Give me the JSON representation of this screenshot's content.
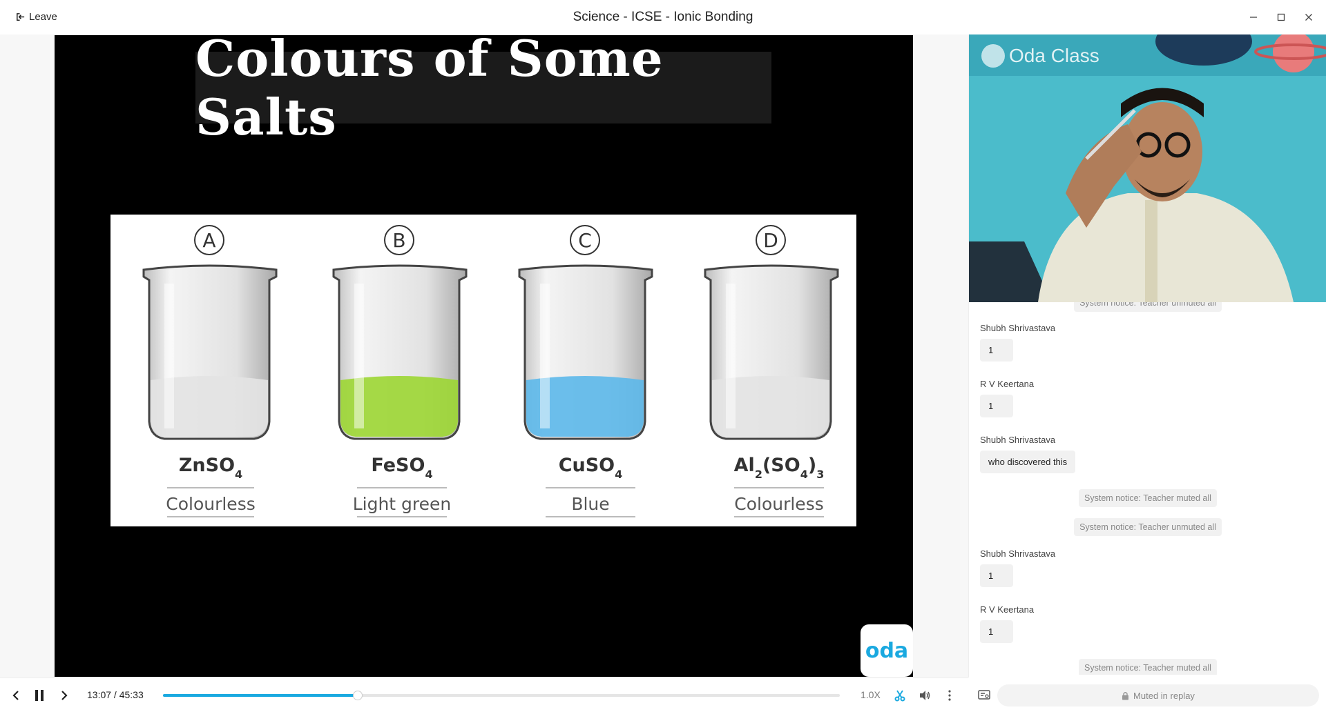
{
  "window": {
    "title": "Science - ICSE - Ionic Bonding",
    "leave_label": "Leave"
  },
  "slide": {
    "title": "Colours of Some Salts",
    "beakers": [
      {
        "letter": "A",
        "formula_main": "ZnSO",
        "formula_sub": "4",
        "colour_label": "Colourless",
        "liquid_color": "#e3e3e3"
      },
      {
        "letter": "B",
        "formula_main": "FeSO",
        "formula_sub": "4",
        "colour_label": "Light green",
        "liquid_color": "#9cd633"
      },
      {
        "letter": "C",
        "formula_main": "CuSO",
        "formula_sub": "4",
        "colour_label": "Blue",
        "liquid_color": "#5cb8ea"
      },
      {
        "letter": "D",
        "formula_main": "Al",
        "formula_sub": "2",
        "formula_mid": "(SO",
        "formula_sub2": "4",
        "formula_end": ")",
        "formula_sub3": "3",
        "colour_label": "Colourless",
        "liquid_color": "#e3e3e3"
      }
    ],
    "badge": "oda"
  },
  "video": {
    "watermark": "Oda Class"
  },
  "chat": {
    "top_notice_partial": "System notice: Teacher unmuted all",
    "messages": [
      {
        "name": "Shubh Shrivastava",
        "text": "1"
      },
      {
        "name": "R V Keertana",
        "text": "1"
      },
      {
        "name": "Shubh Shrivastava",
        "text": "who discovered this"
      },
      {
        "notice": "System notice: Teacher muted all"
      },
      {
        "notice": "System notice: Teacher unmuted all"
      },
      {
        "name": "Shubh Shrivastava",
        "text": "1"
      },
      {
        "name": "R V Keertana",
        "text": "1"
      },
      {
        "notice": "System notice: Teacher muted all"
      }
    ],
    "footer": "Muted in replay"
  },
  "player": {
    "time": "13:07 / 45:33",
    "progress": 0.288,
    "speed": "1.0X"
  },
  "colors": {
    "accent": "#1aa9e0"
  }
}
